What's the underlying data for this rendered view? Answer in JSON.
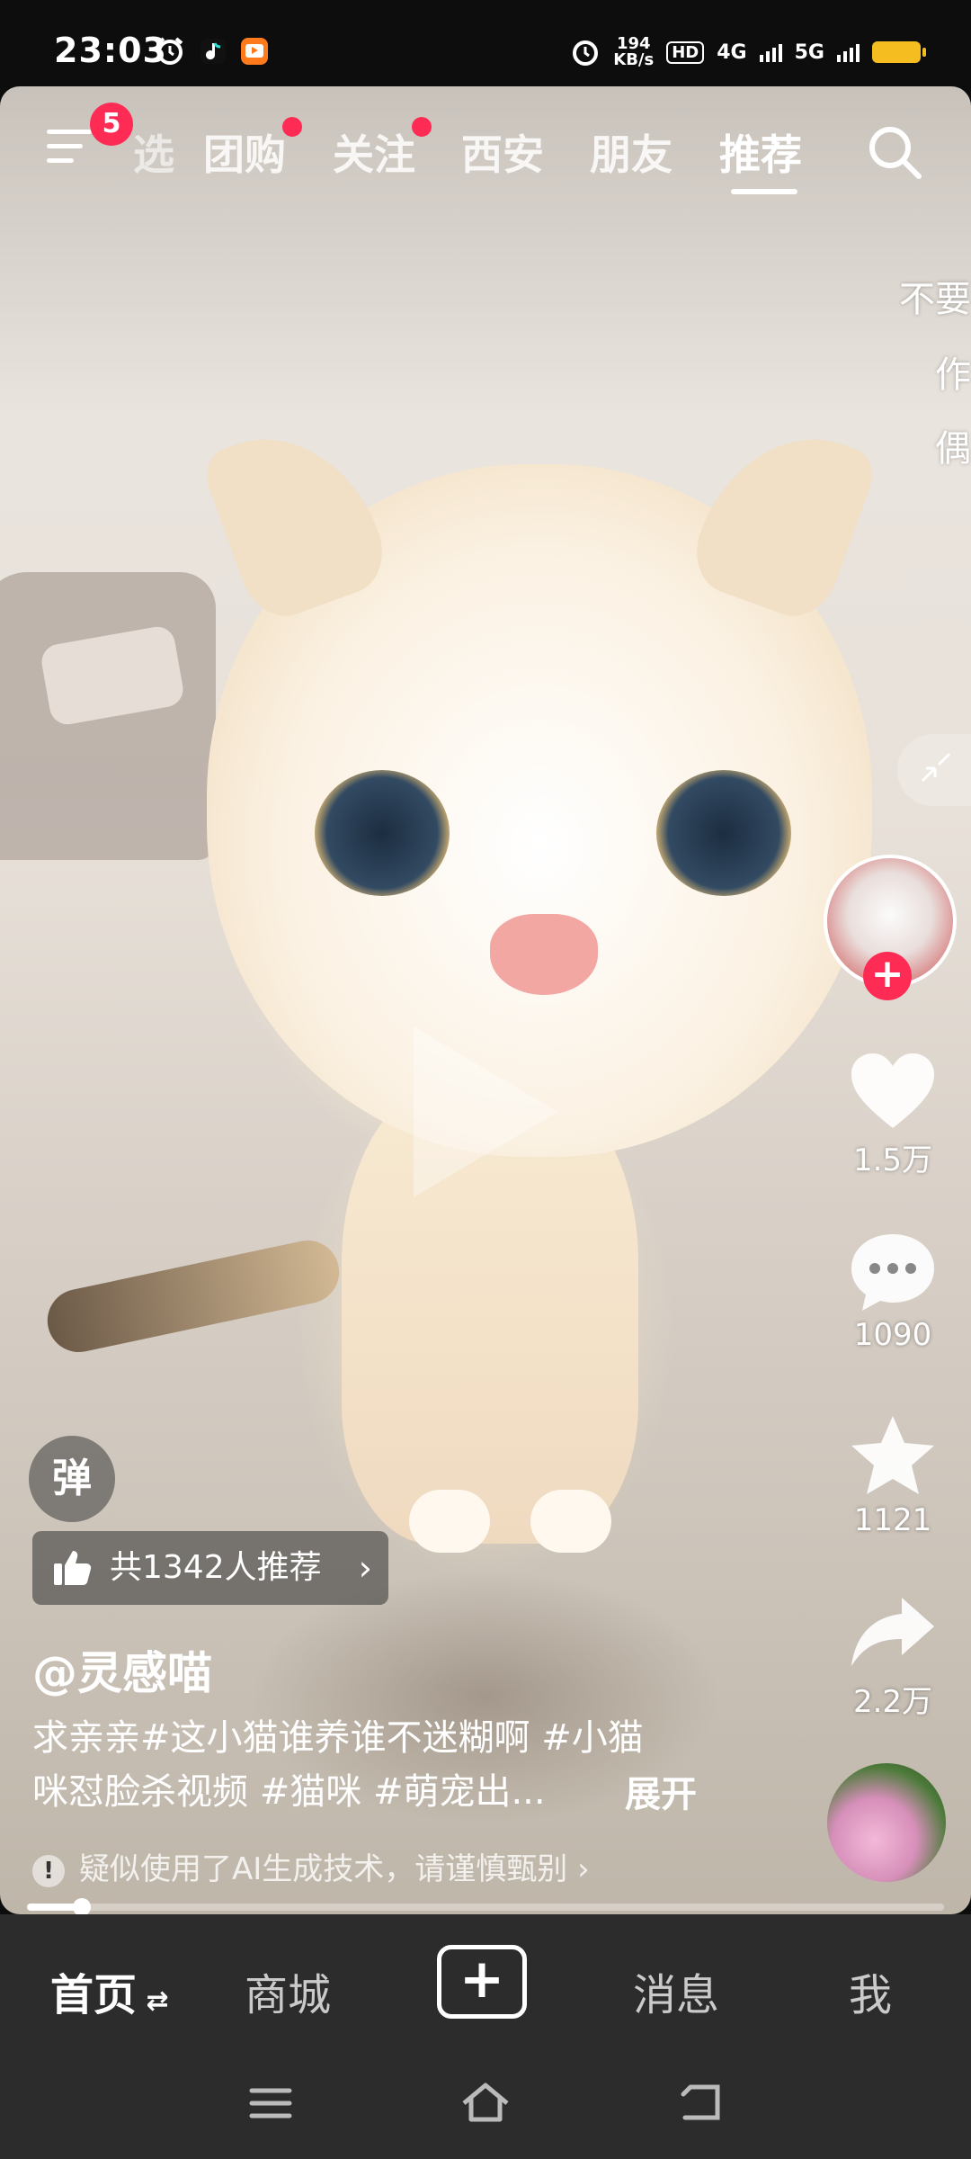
{
  "status_bar": {
    "time": "23:03",
    "left_icons": [
      "alarm-icon",
      "music-app-icon",
      "video-app-icon"
    ],
    "net_speed_value": "194",
    "net_speed_unit": "KB/s",
    "hd_label": "HD",
    "network_4g": "4G",
    "network_5g": "5G",
    "battery_color": "#f5bd1f"
  },
  "top_nav": {
    "menu_badge": "5",
    "tabs": [
      {
        "label": "选",
        "dot": false
      },
      {
        "label": "团购",
        "dot": true
      },
      {
        "label": "关注",
        "dot": true
      },
      {
        "label": "西安",
        "dot": false
      },
      {
        "label": "朋友",
        "dot": false
      },
      {
        "label": "推荐",
        "dot": false,
        "active": true
      }
    ],
    "accent_color": "#fe2c55"
  },
  "overlay_fragments": [
    "不要",
    "作",
    "偶"
  ],
  "sidebar": {
    "likes": "1.5万",
    "comments": "1090",
    "favorites": "1121",
    "shares": "2.2万"
  },
  "video_info": {
    "danmu_label": "弹",
    "recommend_text": "共1342人推荐",
    "author": "@灵感喵",
    "caption_line1": "求亲亲#这小猫谁养谁不迷糊啊 #小猫",
    "caption_line2": "咪怼脸杀视频 #猫咪 #萌宠出...",
    "expand_label": "展开",
    "ai_notice": "疑似使用了AI生成技术，请谨慎甄别",
    "progress": 0.06
  },
  "bottom_nav": {
    "home": "首页",
    "mall": "商城",
    "messages": "消息",
    "me": "我"
  }
}
